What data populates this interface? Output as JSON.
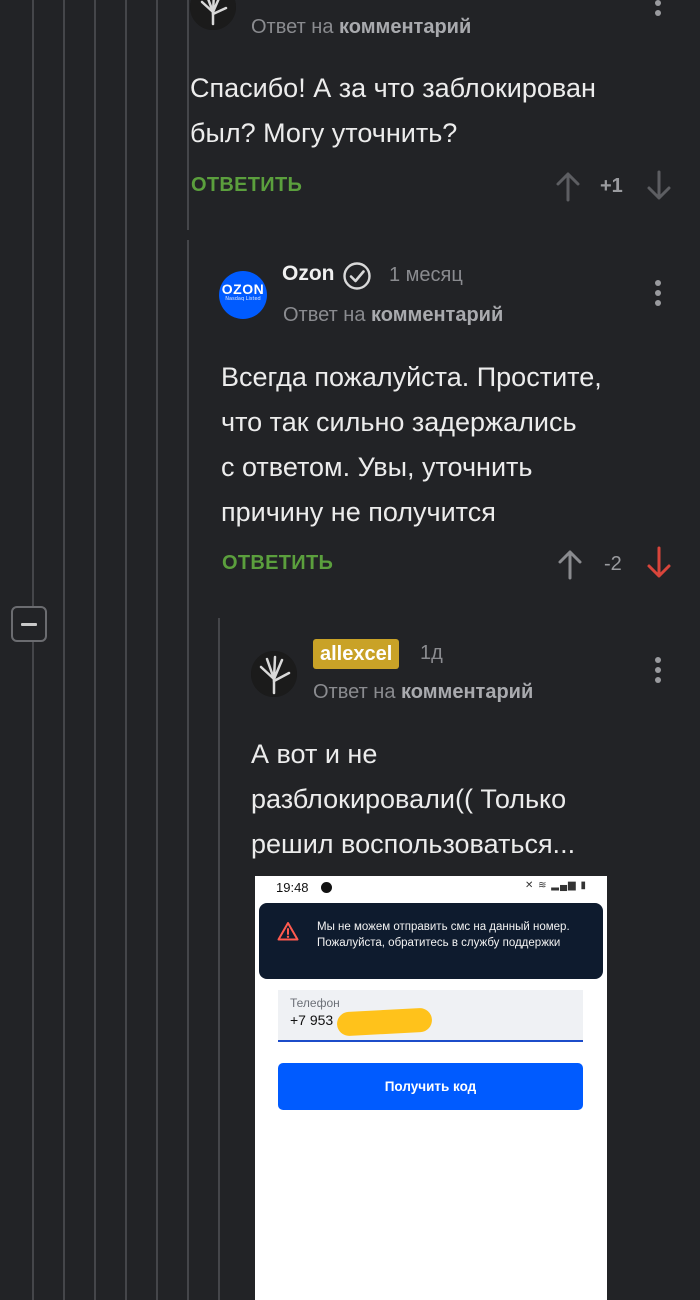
{
  "thread": {
    "collapse_label": "−"
  },
  "comments": [
    {
      "id": "c1",
      "reply_prefix": "Ответ на",
      "reply_target": "комментарий",
      "text_lines": [
        "Спасибо! А за что заблокирован",
        "был? Могу уточнить?"
      ],
      "reply_label": "ОТВЕТИТЬ",
      "score": "+1",
      "avatar_icon": "skeleton-hand-icon"
    },
    {
      "id": "c2",
      "author": "Ozon",
      "verified": true,
      "time": "1 месяц",
      "reply_prefix": "Ответ на",
      "reply_target": "комментарий",
      "avatar_text": "OZON",
      "avatar_subtext": "Nasdaq Listed",
      "text_lines": [
        "Всегда пожалуйста. Простите,",
        "что так сильно задержались",
        "с ответом. Увы, уточнить",
        "причину не получится"
      ],
      "reply_label": "ОТВЕТИТЬ",
      "score": "-2"
    },
    {
      "id": "c3",
      "author": "allexcel",
      "time": "1д",
      "reply_prefix": "Ответ на",
      "reply_target": "комментарий",
      "text_lines": [
        "А вот и не",
        "разблокировали(( Только",
        "решил воспользоваться..."
      ],
      "avatar_icon": "skeleton-hand-icon"
    }
  ],
  "screenshot": {
    "status_time": "19:48",
    "status_right": "✕ ≋ ▂▄▆ ▮",
    "toast_text": "Мы не можем отправить смс на данный номер. Пожалуйста, обратитесь в службу поддержки",
    "phone_label": "Телефон",
    "phone_value": "+7 953",
    "button_label": "Получить код"
  },
  "colors": {
    "background": "#222326",
    "reply_green": "#5b9f3d",
    "downvote_red": "#d9453b",
    "badge_gold": "#c9a227",
    "ozon_blue": "#005bff"
  }
}
